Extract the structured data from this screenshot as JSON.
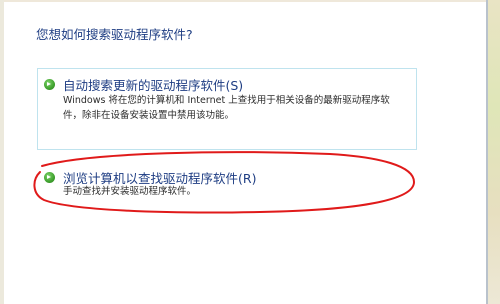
{
  "dialog": {
    "question": "您想如何搜索驱动程序软件?"
  },
  "options": [
    {
      "title": "自动搜索更新的驱动程序软件(S)",
      "description_line1": "Windows 将在您的计算机和 Internet 上查找用于相关设备的最新驱动程序软",
      "description_line2": "件，除非在设备安装设置中禁用该功能。",
      "icon": "green-arrow-icon"
    },
    {
      "title": "浏览计算机以查找驱动程序软件(R)",
      "description_line1": "手动查找并安装驱动程序软件。",
      "icon": "green-arrow-icon"
    }
  ],
  "annotation": {
    "color": "#e01a1a"
  },
  "colors": {
    "title_blue": "#1e3d83",
    "border_light_blue": "#bfe3ee",
    "arrow_green": "#3fa12e"
  }
}
